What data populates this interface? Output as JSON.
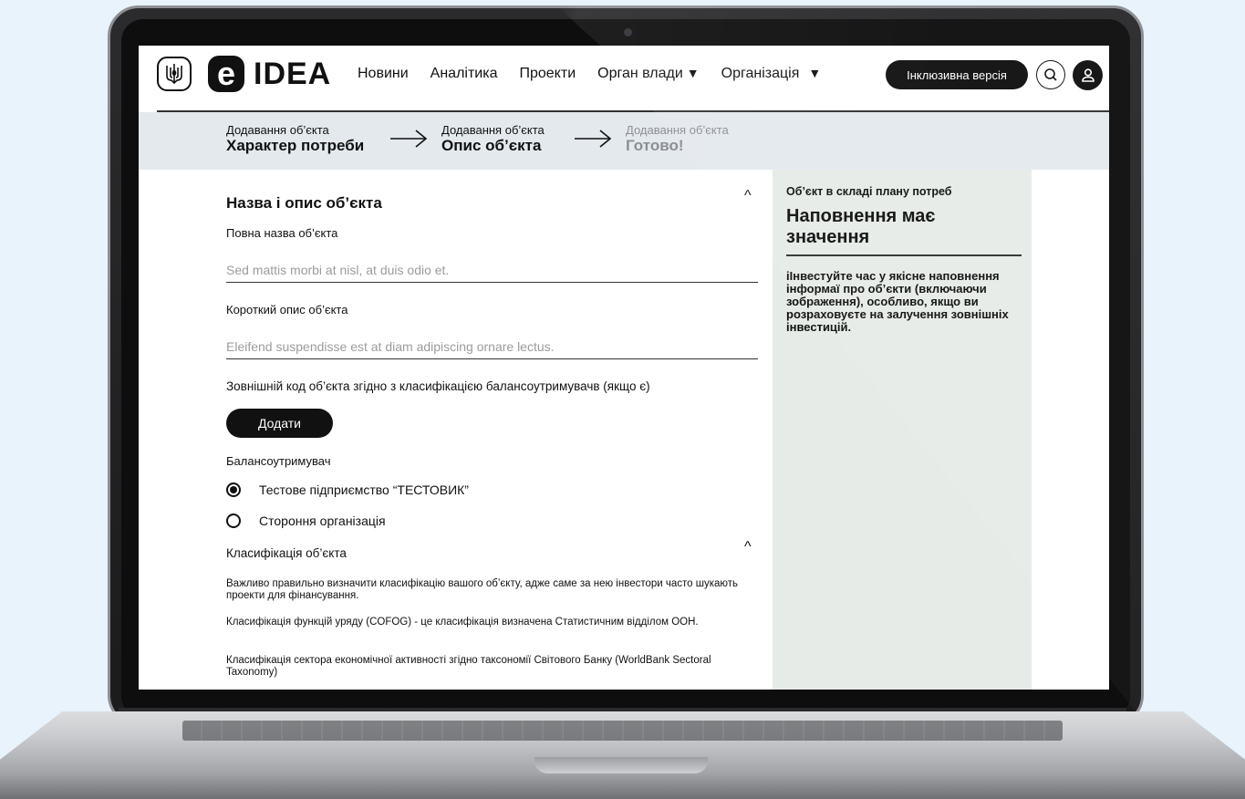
{
  "nav": {
    "logo_e": "e",
    "logo_text": "IDEA",
    "items": [
      "Новини",
      "Аналітика",
      "Проекти",
      "Орган влади",
      "Організація"
    ],
    "dropdown_marker": "▼",
    "inclusive_version": "Інклюзивна версія",
    "icons": [
      "trident-icon",
      "search-icon",
      "user-icon"
    ]
  },
  "stepper": {
    "steps": [
      {
        "sub": "Додавання об’єкта",
        "main": "Характер потреби"
      },
      {
        "sub": "Додавання об’єкта",
        "main": "Опис об’єкта"
      },
      {
        "sub": "Додавання об’єкта",
        "main": "Готово!"
      }
    ]
  },
  "form": {
    "section_title": "Назва і опис об’єкта",
    "full_name_label": "Повна назва об’єкта",
    "full_name_placeholder": "Sed mattis morbi at nisl, at duis odio et.",
    "short_desc_label": "Короткий опис об’єкта",
    "short_desc_placeholder": "Eleifend suspendisse est at diam adipiscing ornare lectus.",
    "external_code_label": "Зовнішній код об’єкта згідно з класифікацією балансоутримувачв (якщо є)",
    "add_button": "Додати",
    "balance_holder_label": "Балансоутримувач",
    "radio_options": [
      {
        "label": "Тестове підприємство “ТЕСТОВИК”",
        "selected": true
      },
      {
        "label": "Стороння організація",
        "selected": false
      }
    ],
    "classification_title": "Класифікація об’єкта",
    "classification_text_1": "Важливо правильно визначити класифікацію вашого об’єкту, адже саме за нею інвестори часто шукають проекти для фінансування.",
    "classification_text_2": "Класифікація функцій уряду (COFOG) - це класифікація визначена Статистичним відділом ООН.",
    "classification_text_3": "Класифікація сектора економічної активності згідно таксономії Світового Банку (WorldBank Sectoral Taxonomy)",
    "chevron": "^"
  },
  "sidebar": {
    "subtitle": "Об’єкт в складі плану потреб",
    "title": "Наповнення має значення",
    "text": "іІнвестуйте час у якісне наповнення інформаї про об’єкти (включаючи зображення), особливо, якщо ви розраховуєте на залучення зовнішніх інвестицій."
  },
  "colors": {
    "background": "#e8f3fb",
    "stepper_bg": "#e4e9ed",
    "sidebar_bg": "#e6ebe7",
    "accent": "#111111",
    "done_step": "#8c8f92"
  }
}
